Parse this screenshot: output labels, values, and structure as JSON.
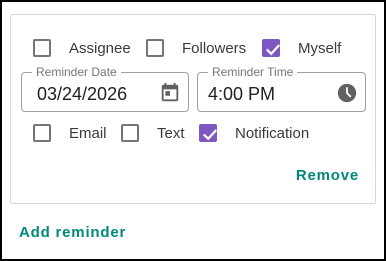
{
  "recipients": {
    "assignee": {
      "label": "Assignee",
      "checked": false
    },
    "followers": {
      "label": "Followers",
      "checked": false
    },
    "myself": {
      "label": "Myself",
      "checked": true
    }
  },
  "reminder_date": {
    "label": "Reminder Date",
    "value": "03/24/2026",
    "icon": "calendar-icon"
  },
  "reminder_time": {
    "label": "Reminder Time",
    "value": "4:00 PM",
    "icon": "clock-icon"
  },
  "channels": {
    "email": {
      "label": "Email",
      "checked": false
    },
    "text": {
      "label": "Text",
      "checked": false
    },
    "notification": {
      "label": "Notification",
      "checked": true
    }
  },
  "actions": {
    "remove_label": "Remove",
    "add_label": "Add reminder"
  },
  "colors": {
    "accent": "#00897b",
    "checkbox_checked": "#7e57c2",
    "border": "#9e9e9e"
  }
}
